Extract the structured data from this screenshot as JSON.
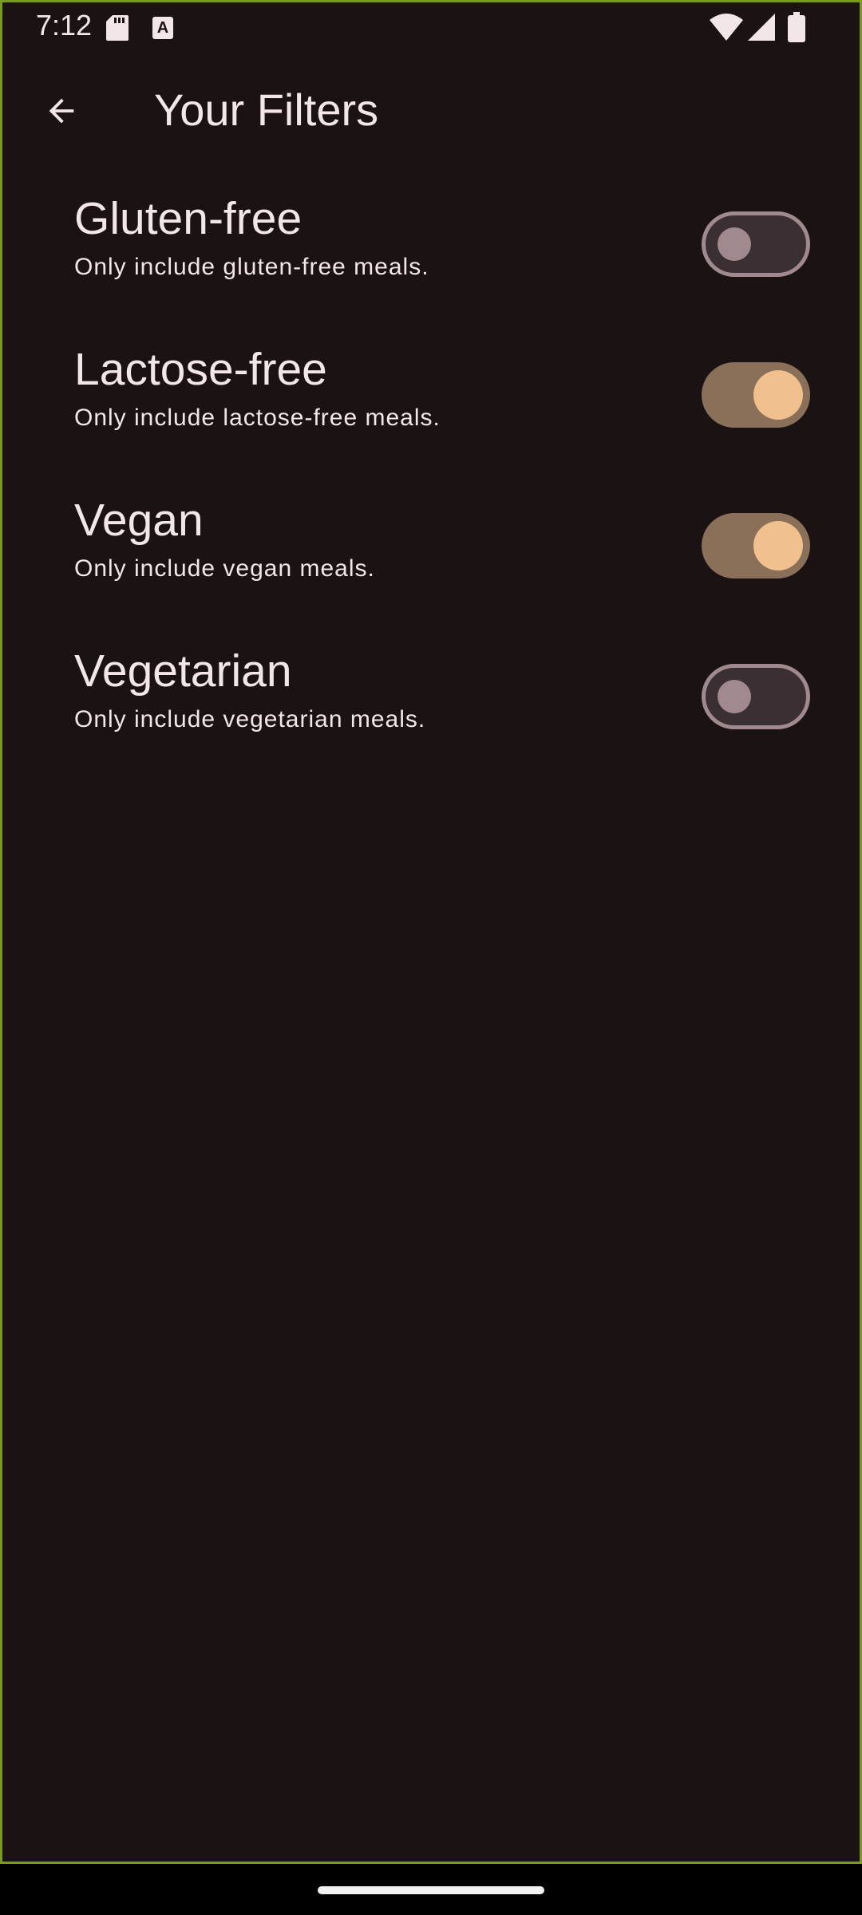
{
  "status_bar": {
    "time": "7:12",
    "icons": [
      "sd-card-icon",
      "keyboard-a-icon",
      "wifi-icon",
      "cell-signal-icon",
      "battery-icon"
    ],
    "a_glyph": "A"
  },
  "app_bar": {
    "title": "Your Filters",
    "back_icon": "arrow-back-icon"
  },
  "filters": [
    {
      "title": "Gluten-free",
      "subtitle": "Only include gluten-free meals.",
      "enabled": false
    },
    {
      "title": "Lactose-free",
      "subtitle": "Only include lactose-free meals.",
      "enabled": true
    },
    {
      "title": "Vegan",
      "subtitle": "Only include vegan meals.",
      "enabled": true
    },
    {
      "title": "Vegetarian",
      "subtitle": "Only include vegetarian meals.",
      "enabled": false
    }
  ],
  "colors": {
    "background": "#1b1214",
    "text": "#f2e6e8",
    "switch_on_track": "#8a7058",
    "switch_on_thumb": "#f0c08e",
    "switch_off_track": "#3a3033",
    "switch_off_outline": "#a08a90"
  }
}
